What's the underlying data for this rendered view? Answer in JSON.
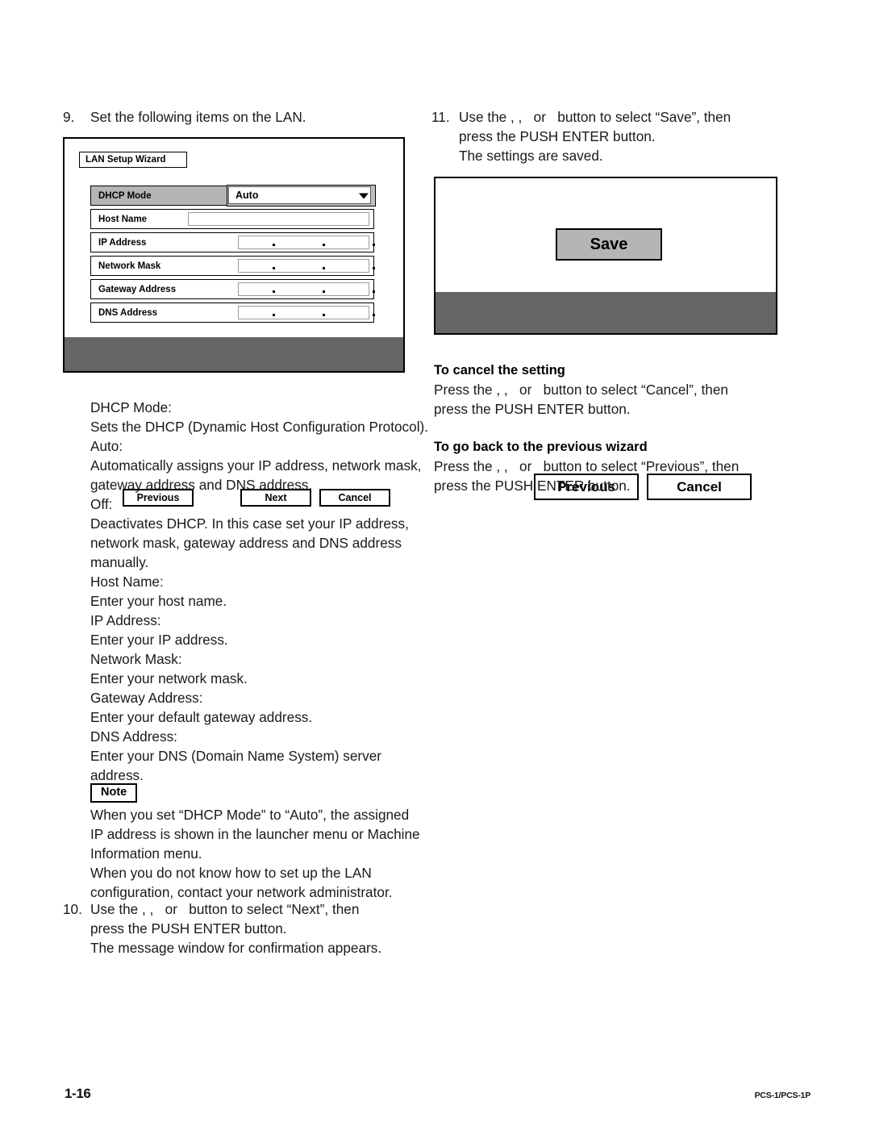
{
  "page": {
    "number": "1-16",
    "model": "PCS-1/PCS-1P"
  },
  "left_column": {
    "step9": {
      "number": "9.",
      "text": "Set the following items on the LAN."
    },
    "descriptions": [
      "DHCP Mode:",
      "Sets the DHCP (Dynamic Host Configuration Protocol).",
      "Auto:",
      "Automatically assigns your IP address, network mask,",
      "gateway address and DNS address.",
      "Off:",
      "Deactivates DHCP. In this case set your IP address,",
      "network mask, gateway address and DNS address",
      "manually.",
      "Host Name:",
      "Enter your host name.",
      "IP Address:",
      "Enter your IP address.",
      "Network Mask:",
      "Enter your network mask.",
      "Gateway Address:",
      "Enter your default gateway address.",
      "DNS Address:",
      "Enter your DNS (Domain Name System) server",
      "address."
    ],
    "note": {
      "badge": "Note",
      "lines": [
        "When you set “DHCP Mode” to “Auto”, the assigned",
        "IP address is shown in the launcher menu or Machine",
        "Information menu.",
        "When you do not know how to set up the LAN",
        "configuration, contact your network administrator."
      ]
    },
    "step10": {
      "number": "10.",
      "lines": [
        "Use the , ,   or   button to select “Next”, then",
        "press the PUSH ENTER button.",
        "The message window for confirmation appears."
      ]
    }
  },
  "right_column": {
    "step11": {
      "number": "11.",
      "lines": [
        "Use the , ,   or   button to select “Save”, then",
        "press the PUSH ENTER button.",
        "The settings are saved."
      ]
    },
    "cancel_section": {
      "heading": "To cancel the setting",
      "lines": [
        "Press the , ,   or   button to select “Cancel”, then",
        "press the PUSH ENTER button."
      ]
    },
    "previous_section": {
      "heading": "To go back to the previous wizard",
      "lines": [
        "Press the , ,   or   button to select “Previous”, then",
        "press the PUSH ENTER button."
      ]
    }
  },
  "lan_wizard_dialog": {
    "title": "LAN Setup Wizard",
    "rows": [
      {
        "label": "DHCP Mode",
        "type": "combo",
        "value": "Auto",
        "selected": true
      },
      {
        "label": "Host Name",
        "type": "text",
        "value": "",
        "selected": false
      },
      {
        "label": "IP Address",
        "type": "ip",
        "value": "",
        "selected": false
      },
      {
        "label": "Network Mask",
        "type": "ip",
        "value": "",
        "selected": false
      },
      {
        "label": "Gateway Address",
        "type": "ip",
        "value": "",
        "selected": false
      },
      {
        "label": "DNS Address",
        "type": "ip",
        "value": "",
        "selected": false
      }
    ],
    "buttons": {
      "previous": "Previous",
      "next": "Next",
      "cancel": "Cancel"
    }
  },
  "save_dialog": {
    "save_label": "Save",
    "buttons": {
      "previous": "Previous",
      "cancel": "Cancel"
    }
  },
  "colors": {
    "footer_gray": "#666666",
    "row_selected_gray": "#b5b5b5",
    "combo_frame_gray": "#c0c0c0",
    "text_black": "#000000"
  }
}
